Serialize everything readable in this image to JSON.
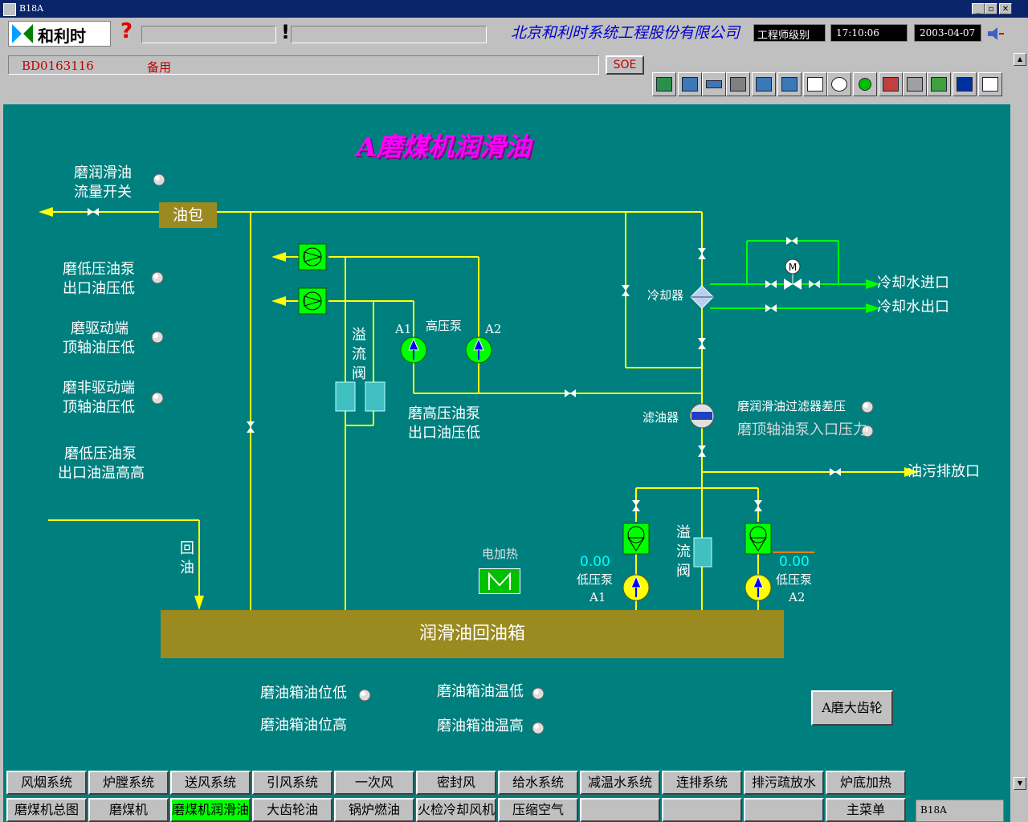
{
  "window": {
    "title": "B18A",
    "min": "_",
    "max": "▫",
    "close": "✕"
  },
  "header": {
    "logo_text": "和利时",
    "help_glyph": "?",
    "alarm_glyph": "!",
    "company": "北京和利时系统工程股份有限公司",
    "level": "工程师级别",
    "time": "17:10:06",
    "date": "2003-04-07",
    "point_id": "BD0163116",
    "point_desc": "备用",
    "soe": "SOE"
  },
  "diagram": {
    "title": "A磨煤机润滑油",
    "flow_switch_l1": "磨润滑油",
    "flow_switch_l2": "流量开关",
    "oil_bag": "油包",
    "lp_pump_pressure_l1": "磨低压油泵",
    "lp_pump_pressure_l2": "出口油压低",
    "drive_end_l1": "磨驱动端",
    "drive_end_l2": "顶轴油压低",
    "nondrive_end_l1": "磨非驱动端",
    "nondrive_end_l2": "顶轴油压低",
    "lp_pump_temp_l1": "磨低压油泵",
    "lp_pump_temp_l2": "出口油温高高",
    "overflow_valve_1": [
      "溢",
      "流",
      "阀"
    ],
    "a1": "A1",
    "a2": "A2",
    "hp_pump": "高压泵",
    "hp_pump_pressure_l1": "磨高压油泵",
    "hp_pump_pressure_l2": "出口油压低",
    "cooler": "冷却器",
    "cooling_in": "冷却水进口",
    "cooling_out": "冷却水出口",
    "motor": "M",
    "filter": "滤油器",
    "filter_dp": "磨润滑油过滤器差压",
    "jack_pump_inlet": "磨顶轴油泵入口压力",
    "drain": "油污排放口",
    "return_oil": [
      "回",
      "油"
    ],
    "heater": "电加热",
    "lp_pump1_value": "0.00",
    "lp_pump1_label": "低压泵",
    "lp_pump1_id": "A1",
    "overflow_valve_2": [
      "溢",
      "流",
      "阀"
    ],
    "lp_pump2_value": "0.00",
    "lp_pump2_label": "低压泵",
    "lp_pump2_id": "A2",
    "tank": "润滑油回油箱",
    "tank_level_low": "磨油箱油位低",
    "tank_level_high": "磨油箱油位高",
    "tank_temp_low": "磨油箱油温低",
    "tank_temp_high": "磨油箱油温高",
    "gear_button": "A磨大齿轮"
  },
  "nav_row1": [
    "风烟系统",
    "炉膛系统",
    "送风系统",
    "引风系统",
    "一次风",
    "密封风",
    "给水系统",
    "减温水系统",
    "连排系统",
    "排污疏放水",
    "炉底加热"
  ],
  "nav_row2": [
    "磨煤机总图",
    "磨煤机",
    "磨煤机润滑油",
    "大齿轮油",
    "锅炉燃油",
    "火检冷却风机",
    "压缩空气",
    "",
    "",
    "",
    "主菜单"
  ],
  "nav_active": "磨煤机润滑油",
  "status_tag": "B18A",
  "colors": {
    "background": "#007f7f",
    "pipe": "#ffff00",
    "cooling_pipe": "#00ff00",
    "title": "#ff00ff",
    "value": "#00ffff"
  },
  "icons": [
    "logo-icon",
    "help-icon",
    "alarm-icon",
    "speaker-icon",
    "toolbar-icons",
    "valve-icon",
    "pump-icon",
    "motor-icon",
    "filter-icon",
    "cooler-icon",
    "heater-icon",
    "indicator-lamp"
  ]
}
